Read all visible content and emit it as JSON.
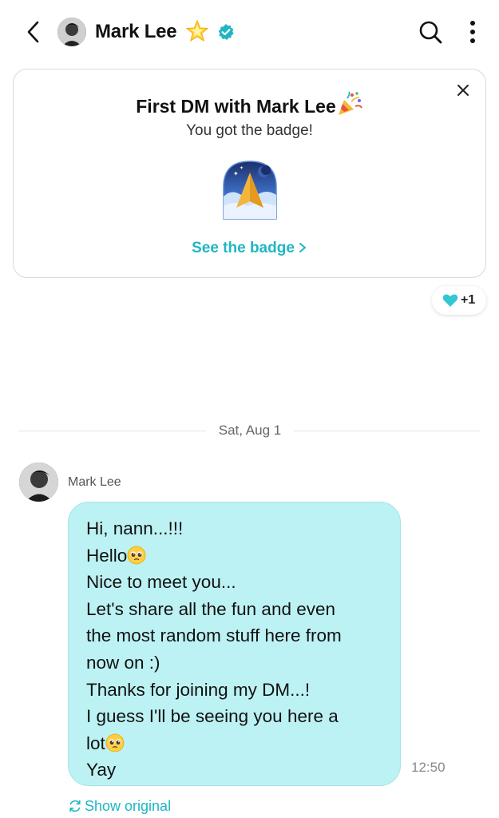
{
  "header": {
    "title": "Mark Lee",
    "star_icon": "glowing-star-icon",
    "verified_icon": "verified-badge-icon"
  },
  "badge_card": {
    "title": "First DM with Mark Lee",
    "subtitle": "You got the badge!",
    "link": "See the badge",
    "badge_icon": "paper-plane-badge-icon"
  },
  "reaction": {
    "icon": "heart-icon",
    "count": "+1"
  },
  "date_separator": "Sat, Aug 1",
  "message": {
    "sender": "Mark Lee",
    "lines": [
      "Hi, nann...!!!",
      "Hello",
      "Nice to meet you...",
      "Let's share all the fun and even",
      "the most random stuff here from",
      "now on :)",
      "Thanks for joining my DM...!",
      "I guess I'll be seeing you here a",
      "lot",
      "Yay"
    ],
    "time": "12:50",
    "show_original": "Show original"
  },
  "colors": {
    "accent": "#1fb6c4",
    "bubble": "#bdf2f4",
    "verified": "#1fb6c4"
  }
}
